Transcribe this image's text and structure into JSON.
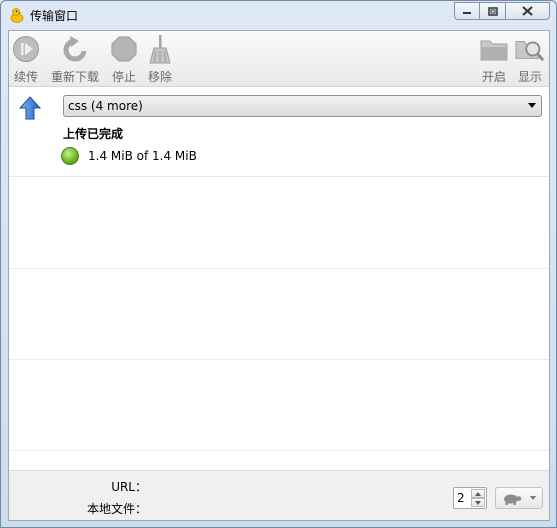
{
  "window": {
    "title": "传输窗口"
  },
  "toolbar": {
    "left": [
      {
        "label": "续传",
        "icon": "resume-icon"
      },
      {
        "label": "重新下载",
        "icon": "reload-icon"
      },
      {
        "label": "停止",
        "icon": "stop-icon"
      },
      {
        "label": "移除",
        "icon": "broom-icon"
      }
    ],
    "right": [
      {
        "label": "开启",
        "icon": "open-folder-icon"
      },
      {
        "label": "显示",
        "icon": "reveal-magnifier-icon"
      }
    ]
  },
  "transfer": {
    "direction_icon": "upload-arrow-icon",
    "selected_file": "css (4 more)",
    "status": "上传已完成",
    "progress_text": "1.4 MiB of 1.4 MiB",
    "progress_fraction": 1.0,
    "status_color": "#5fae1c"
  },
  "footer": {
    "url_label": "URL：",
    "local_file_label": "本地文件：",
    "connections_value": "2",
    "throttle_icon": "turtle-icon"
  }
}
